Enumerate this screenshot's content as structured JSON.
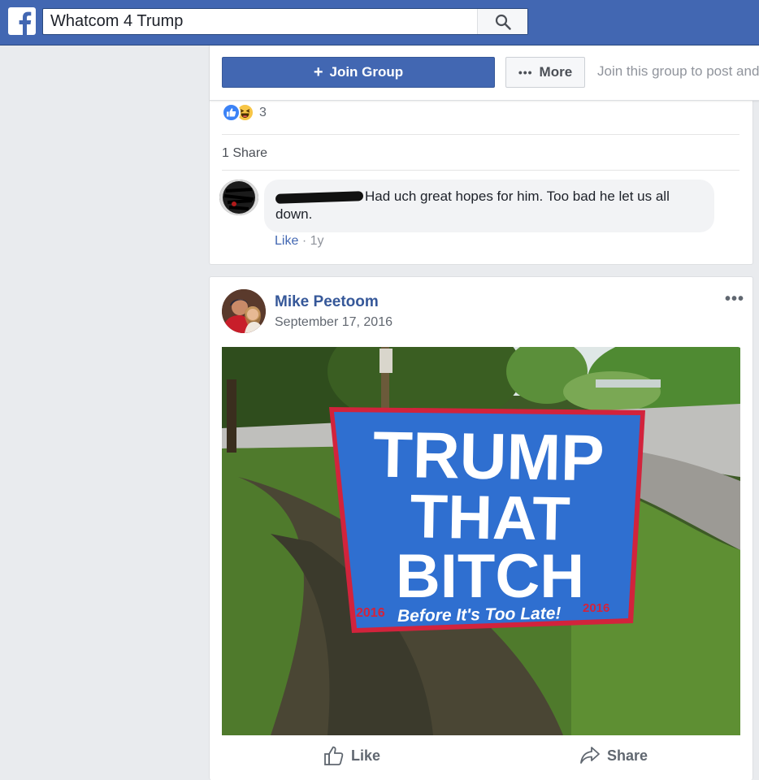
{
  "topbar": {
    "search_value": "Whatcom 4 Trump"
  },
  "group_bar": {
    "join_label": "Join Group",
    "more_label": "More",
    "hint": "Join this group to post and"
  },
  "previous_post": {
    "reaction_count": "3",
    "share_text": "1 Share",
    "comment": {
      "text": "Had uch great hopes for him. Too bad he let us all down.",
      "like_label": "Like",
      "separator": "·",
      "time": "1y"
    }
  },
  "post": {
    "author": "Mike Peetoom",
    "date": "September 17, 2016",
    "sign": {
      "line1": "TRUMP",
      "line2": "THAT",
      "line3": "BITCH",
      "year_left": "2016",
      "tagline": "Before It's Too Late!",
      "year_right": "2016"
    },
    "actions": {
      "like_label": "Like",
      "share_label": "Share"
    }
  },
  "colors": {
    "facebook_blue": "#4267b2",
    "link_blue": "#365899",
    "sign_blue": "#2f6fd0",
    "sign_red": "#d2233c"
  },
  "icons": [
    "facebook-logo-icon",
    "search-icon",
    "plus-icon",
    "more-dots-icon",
    "like-reaction-icon",
    "haha-reaction-icon",
    "post-menu-icon",
    "thumbs-up-icon",
    "share-arrow-icon"
  ]
}
